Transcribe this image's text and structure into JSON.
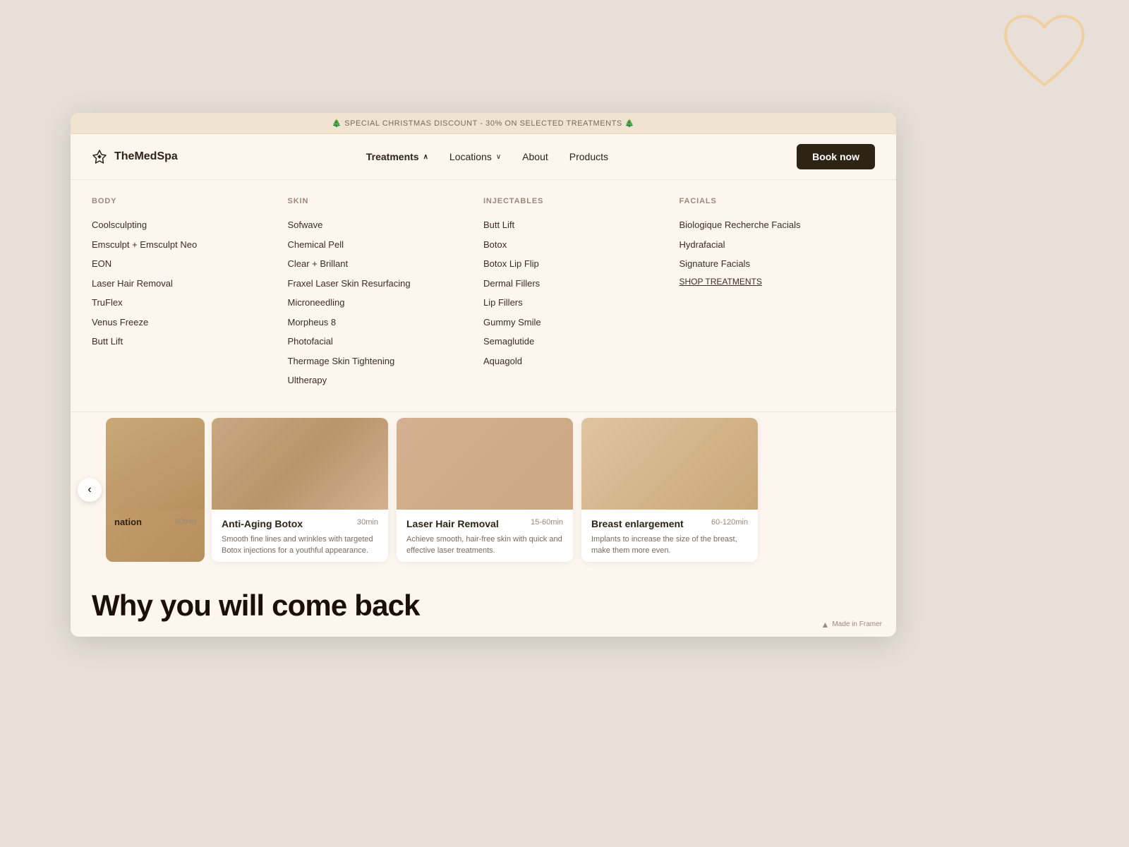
{
  "background": {
    "color": "#e8e0d8"
  },
  "heart": {
    "color": "#f0d8a8"
  },
  "banner": {
    "text": "🎄 SPECIAL CHRISTMAS DISCOUNT - 30% ON SELECTED TREATMENTS 🎄"
  },
  "navbar": {
    "logo_text": "TheMedSpa",
    "nav_items": [
      {
        "label": "Treatments",
        "has_chevron": true,
        "chevron_type": "up",
        "active": true
      },
      {
        "label": "Locations",
        "has_chevron": true,
        "chevron_type": "down"
      },
      {
        "label": "About",
        "has_chevron": false
      },
      {
        "label": "Products",
        "has_chevron": false
      }
    ],
    "book_button": "Book now"
  },
  "dropdown": {
    "columns": [
      {
        "header": "BODY",
        "items": [
          "Coolsculpting",
          "Emsculpt + Emsculpt Neo",
          "EON",
          "Laser Hair Removal",
          "TruFlex",
          "Venus Freeze",
          "Butt Lift"
        ]
      },
      {
        "header": "SKIN",
        "items": [
          "Sofwave",
          "Chemical Pell",
          "Clear + Brillant",
          "Fraxel Laser Skin Resurfacing",
          "Microneedling",
          "Morpheus 8",
          "Photofacial",
          "Thermage Skin Tightening",
          "Ultherapy"
        ]
      },
      {
        "header": "INJECTABLES",
        "items": [
          "Butt Lift",
          "Botox",
          "Botox Lip Flip",
          "Dermal Fillers",
          "Lip Fillers",
          "Gummy Smile",
          "Semaglutide",
          "Aquagold"
        ],
        "shop_link": null
      },
      {
        "header": "FACIALS",
        "items": [
          "Biologique Recherche Facials",
          "Hydrafacial",
          "Signature Facials"
        ],
        "shop_link": "SHOP TREATMENTS"
      }
    ]
  },
  "cards": [
    {
      "title": "Anti-Aging Botox",
      "duration": "30min",
      "description": "Smooth fine lines and wrinkles with targeted Botox injections for a youthful appearance."
    },
    {
      "title": "Laser Hair Removal",
      "duration": "15-60min",
      "description": "Achieve smooth, hair-free skin with quick and effective laser treatments."
    },
    {
      "title": "Breast enlargement",
      "duration": "60-120min",
      "description": "Implants to increase the size of the breast, make them more even."
    }
  ],
  "partial_card": {
    "text": "nation",
    "duration": "60min"
  },
  "bottom": {
    "title": "Why you will come back"
  },
  "framer": {
    "text": "Made in Framer"
  }
}
